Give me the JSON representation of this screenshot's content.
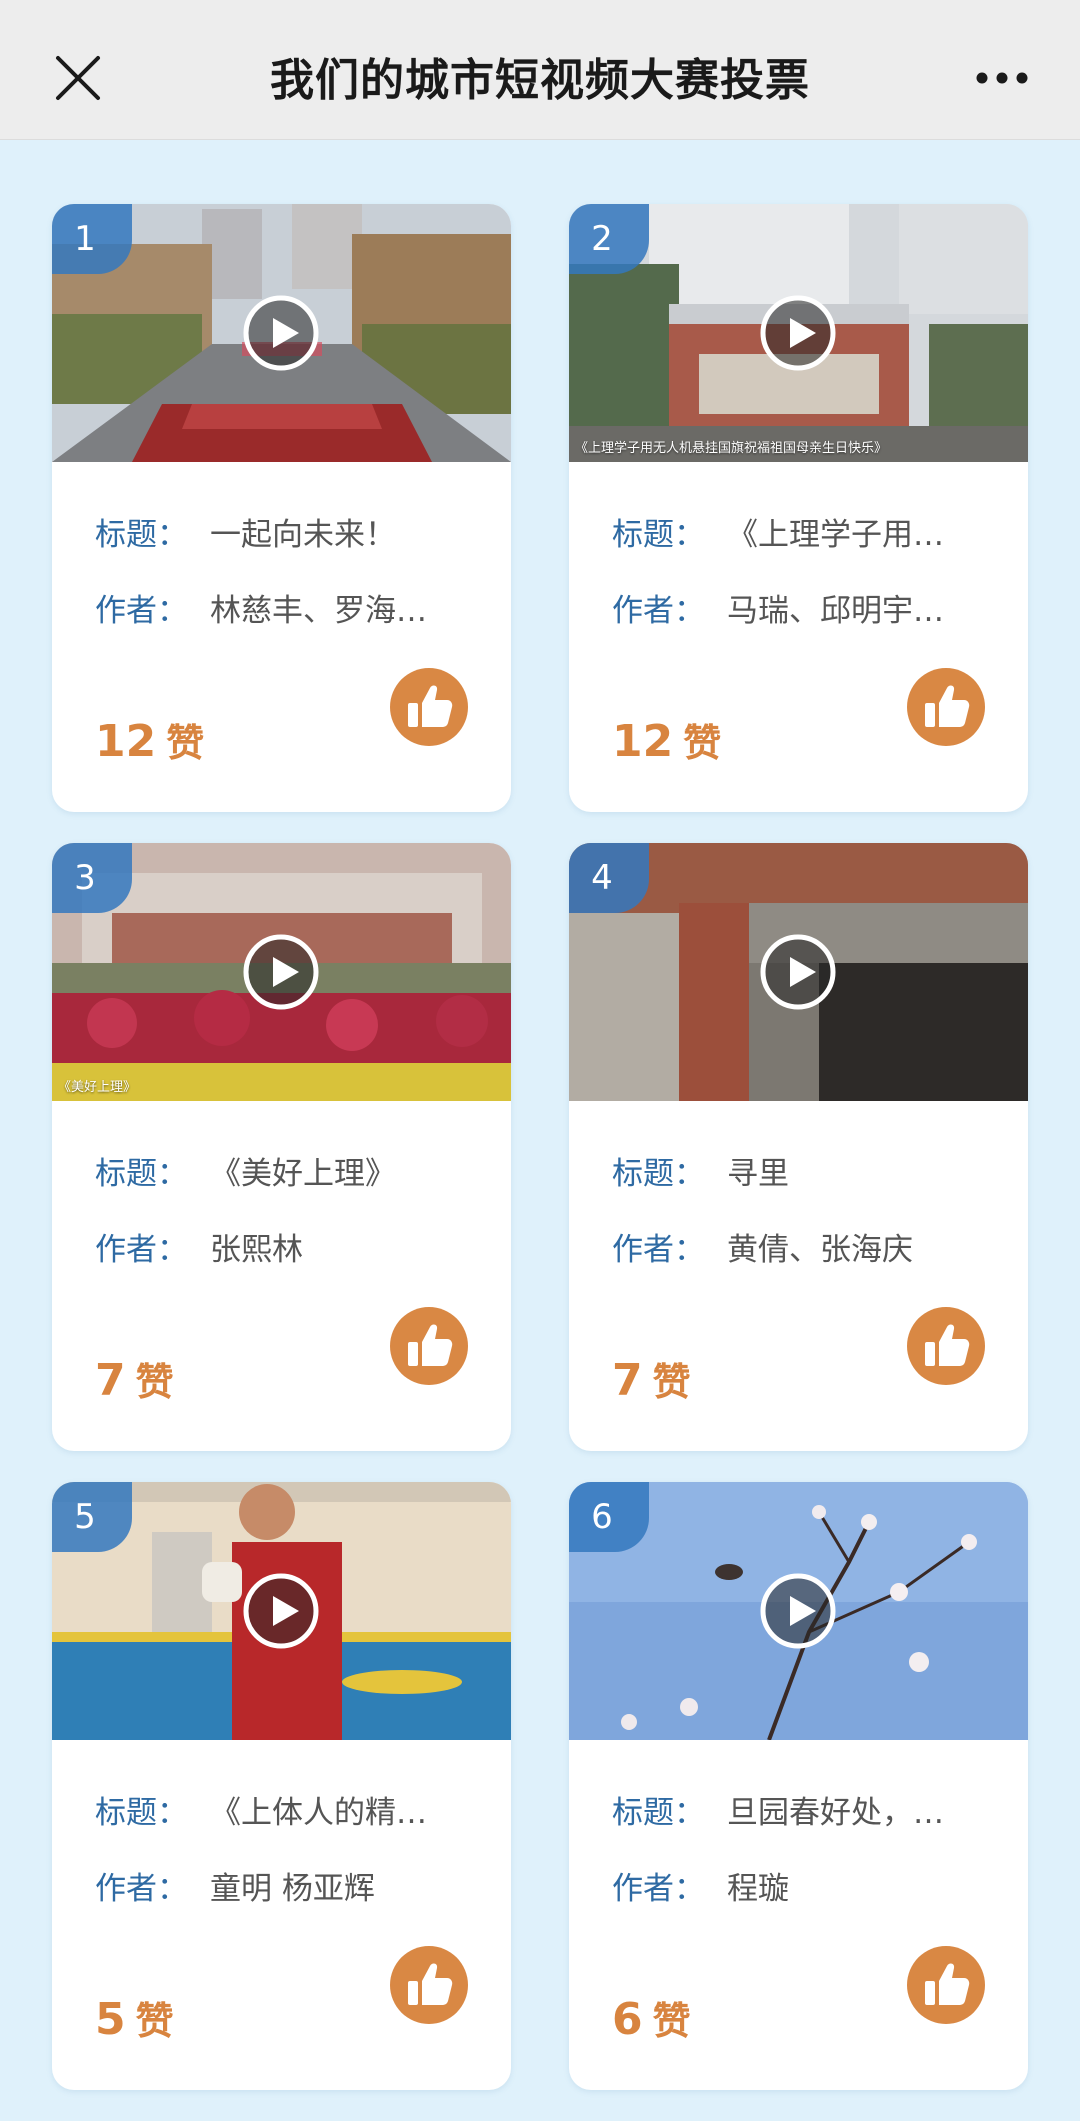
{
  "header": {
    "title": "我们的城市短视频大赛投票"
  },
  "colors": {
    "accent": "#d98844",
    "label_blue": "#2e6aa3",
    "badge_blue": "#3478be",
    "background": "#dff1fb"
  },
  "icons": {
    "close": "close-icon",
    "more": "more-dots-icon",
    "play": "play-icon",
    "like": "thumbs-up-icon"
  },
  "labels": {
    "title": "标题：",
    "author": "作者：",
    "like_unit": "赞"
  },
  "entries": [
    {
      "rank": "1",
      "title": "一起向未来！",
      "author": "林慈丰、罗海…",
      "likes": "12",
      "caption": ""
    },
    {
      "rank": "2",
      "title": "《上理学子用…",
      "author": "马瑞、邱明宇…",
      "likes": "12",
      "caption": "《上理学子用无人机悬挂国旗祝福祖国母亲生日快乐》"
    },
    {
      "rank": "3",
      "title": "《美好上理》",
      "author": "张熙林",
      "likes": "7",
      "caption": "《美好上理》"
    },
    {
      "rank": "4",
      "title": "寻里",
      "author": "黄倩、张海庆",
      "likes": "7",
      "caption": ""
    },
    {
      "rank": "5",
      "title": "《上体人的精…",
      "author": "童明 杨亚辉",
      "likes": "5",
      "caption": ""
    },
    {
      "rank": "6",
      "title": "旦园春好处，…",
      "author": "程璇",
      "likes": "6",
      "caption": ""
    }
  ]
}
